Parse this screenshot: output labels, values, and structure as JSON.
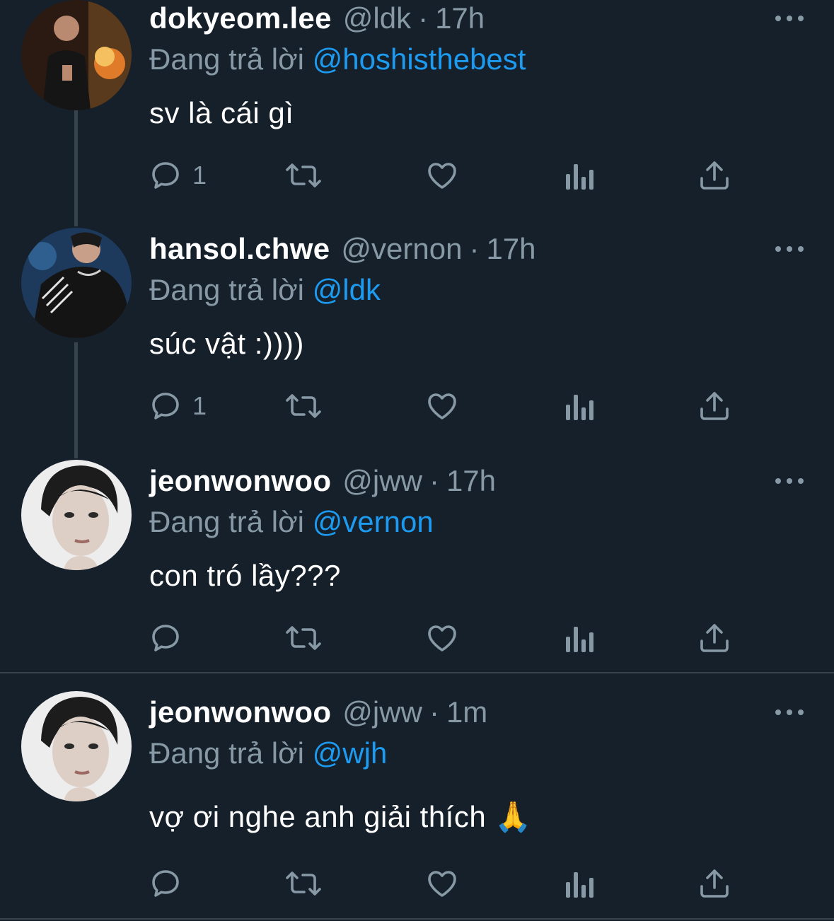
{
  "tweets": [
    {
      "name": "dokyeom.lee",
      "handle": "@ldk",
      "separator": "·",
      "time": "17h",
      "reply_prefix": "Đang trả lời",
      "reply_to": "@hoshisthebest",
      "text": "sv là cái gì",
      "reply_count": "1"
    },
    {
      "name": "hansol.chwe",
      "handle": "@vernon",
      "separator": "·",
      "time": "17h",
      "reply_prefix": "Đang trả lời",
      "reply_to": "@ldk",
      "text": "súc vật :))))",
      "reply_count": "1"
    },
    {
      "name": "jeonwonwoo",
      "handle": "@jww",
      "separator": "·",
      "time": "17h",
      "reply_prefix": "Đang trả lời",
      "reply_to": "@vernon",
      "text": "con tró lầy???",
      "reply_count": ""
    },
    {
      "name": "jeonwonwoo",
      "handle": "@jww",
      "separator": "·",
      "time": "1m",
      "reply_prefix": "Đang trả lời",
      "reply_to": "@wjh",
      "text": "vợ ơi nghe anh giải thích 🙏",
      "reply_count": ""
    }
  ],
  "icons": {
    "reply": "reply-icon",
    "retweet": "retweet-icon",
    "like": "heart-icon",
    "views": "views-icon",
    "share": "share-icon",
    "more": "more-icon"
  },
  "colors": {
    "background": "#15202b",
    "secondary_text": "#8899a6",
    "mention": "#1d9bf0",
    "divider": "#38444d"
  }
}
